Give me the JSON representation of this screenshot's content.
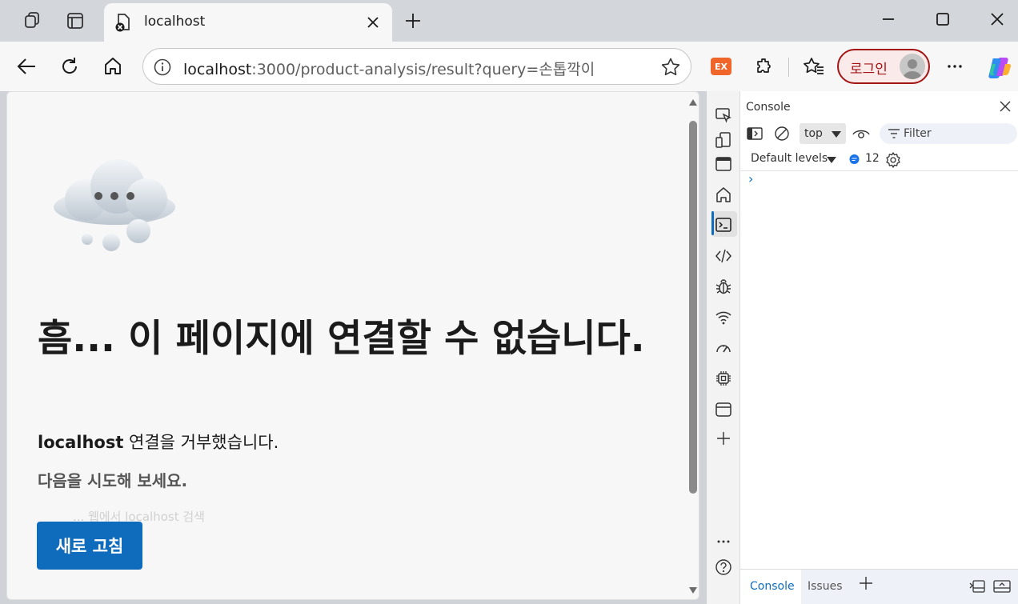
{
  "browser": {
    "tab": {
      "title": "localhost"
    },
    "address": {
      "host": "localhost",
      "path": ":3000/product-analysis/result?query=손톱깍이"
    },
    "extension_badge": "EX",
    "login_label": "로그인"
  },
  "page": {
    "error_title": "흠... 이 페이지에 연결할 수 없습니다.",
    "error_host": "localhost",
    "error_message": " 연결을 거부했습니다.",
    "try_label": "다음을 시도해 보세요.",
    "faded_line": "... 웹에서 localhost 검색",
    "reload_label": "새로 고침"
  },
  "devtools": {
    "panel_title": "Console",
    "context": "top",
    "filter_placeholder": "Filter",
    "levels": "Default levels",
    "message_count": "12",
    "prompt": "›",
    "bottom_tabs": [
      "Console",
      "Issues"
    ]
  },
  "colors": {
    "accent": "#0f6cbd",
    "login_border": "#a31515",
    "extension": "#f0652a"
  }
}
